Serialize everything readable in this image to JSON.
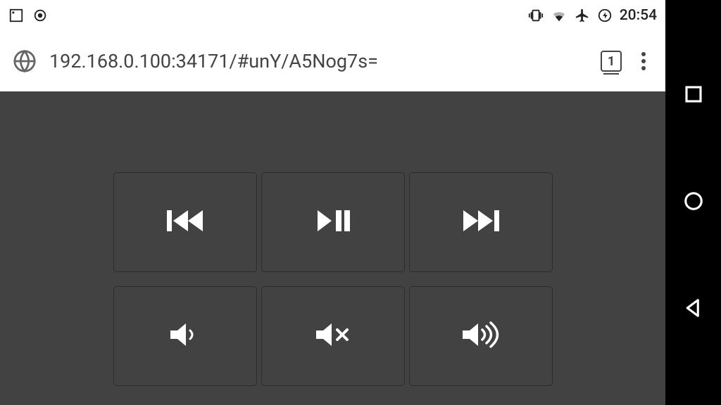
{
  "status_bar": {
    "time": "20:54",
    "icons": {
      "vibrate": "vibrate-icon",
      "wifi": "wifi-icon",
      "airplane": "airplane-icon",
      "battery": "battery-charging-icon"
    },
    "left_icons": {
      "notification": "square-notification-icon",
      "recording": "recording-icon"
    }
  },
  "browser": {
    "url": "192.168.0.100:34171/#unY/A5Nog7s=",
    "tab_count": "1"
  },
  "media_controls": {
    "row1": {
      "previous": "skip-previous-icon",
      "play_pause": "play-pause-icon",
      "next": "skip-next-icon"
    },
    "row2": {
      "vol_down": "volume-down-icon",
      "mute": "volume-mute-icon",
      "vol_up": "volume-up-icon"
    }
  },
  "nav_bar": {
    "back": "back-icon",
    "home": "home-icon",
    "recents": "recents-icon"
  }
}
